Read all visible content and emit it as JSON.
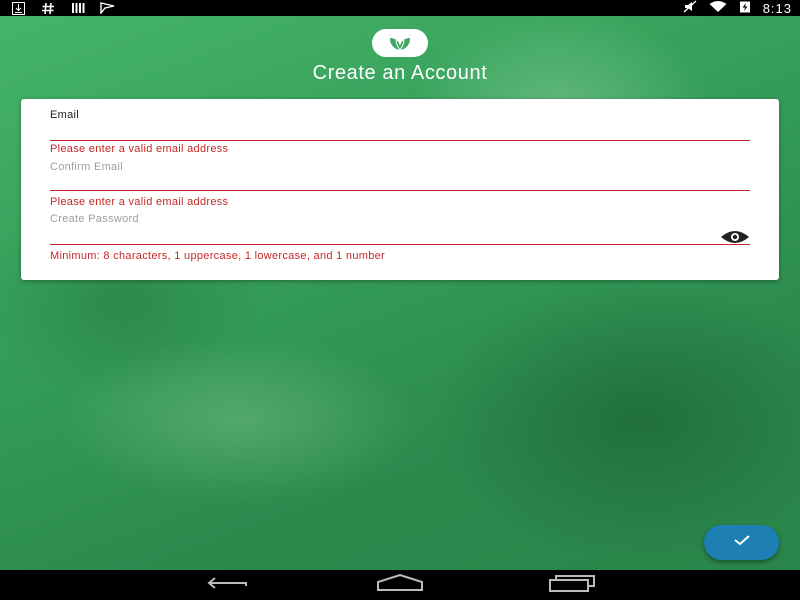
{
  "status_bar": {
    "time": "8:13",
    "icons_left": [
      "download-icon",
      "hash-icon",
      "signal-bars-icon",
      "flag-icon"
    ],
    "icons_right": [
      "mute-icon",
      "wifi-icon",
      "battery-charging-icon"
    ]
  },
  "header": {
    "logo": "leaf-logo-icon",
    "title": "Create an Account"
  },
  "form": {
    "email": {
      "label": "Email",
      "value": "",
      "error": "Please enter a valid email address"
    },
    "confirm_email": {
      "label": "Confirm Email",
      "value": "",
      "error": "Please enter a valid email address"
    },
    "password": {
      "label": "Create Password",
      "value": "",
      "error": "Minimum: 8 characters, 1 uppercase, 1 lowercase, and 1 number",
      "toggle_icon": "eye-icon"
    }
  },
  "fab": {
    "icon": "check-icon"
  },
  "nav_bar": {
    "icons": [
      "back-icon",
      "home-icon",
      "recents-icon"
    ]
  },
  "colors": {
    "error": "#c62828",
    "fab": "#1d7fb3",
    "background": "#36a05a"
  }
}
